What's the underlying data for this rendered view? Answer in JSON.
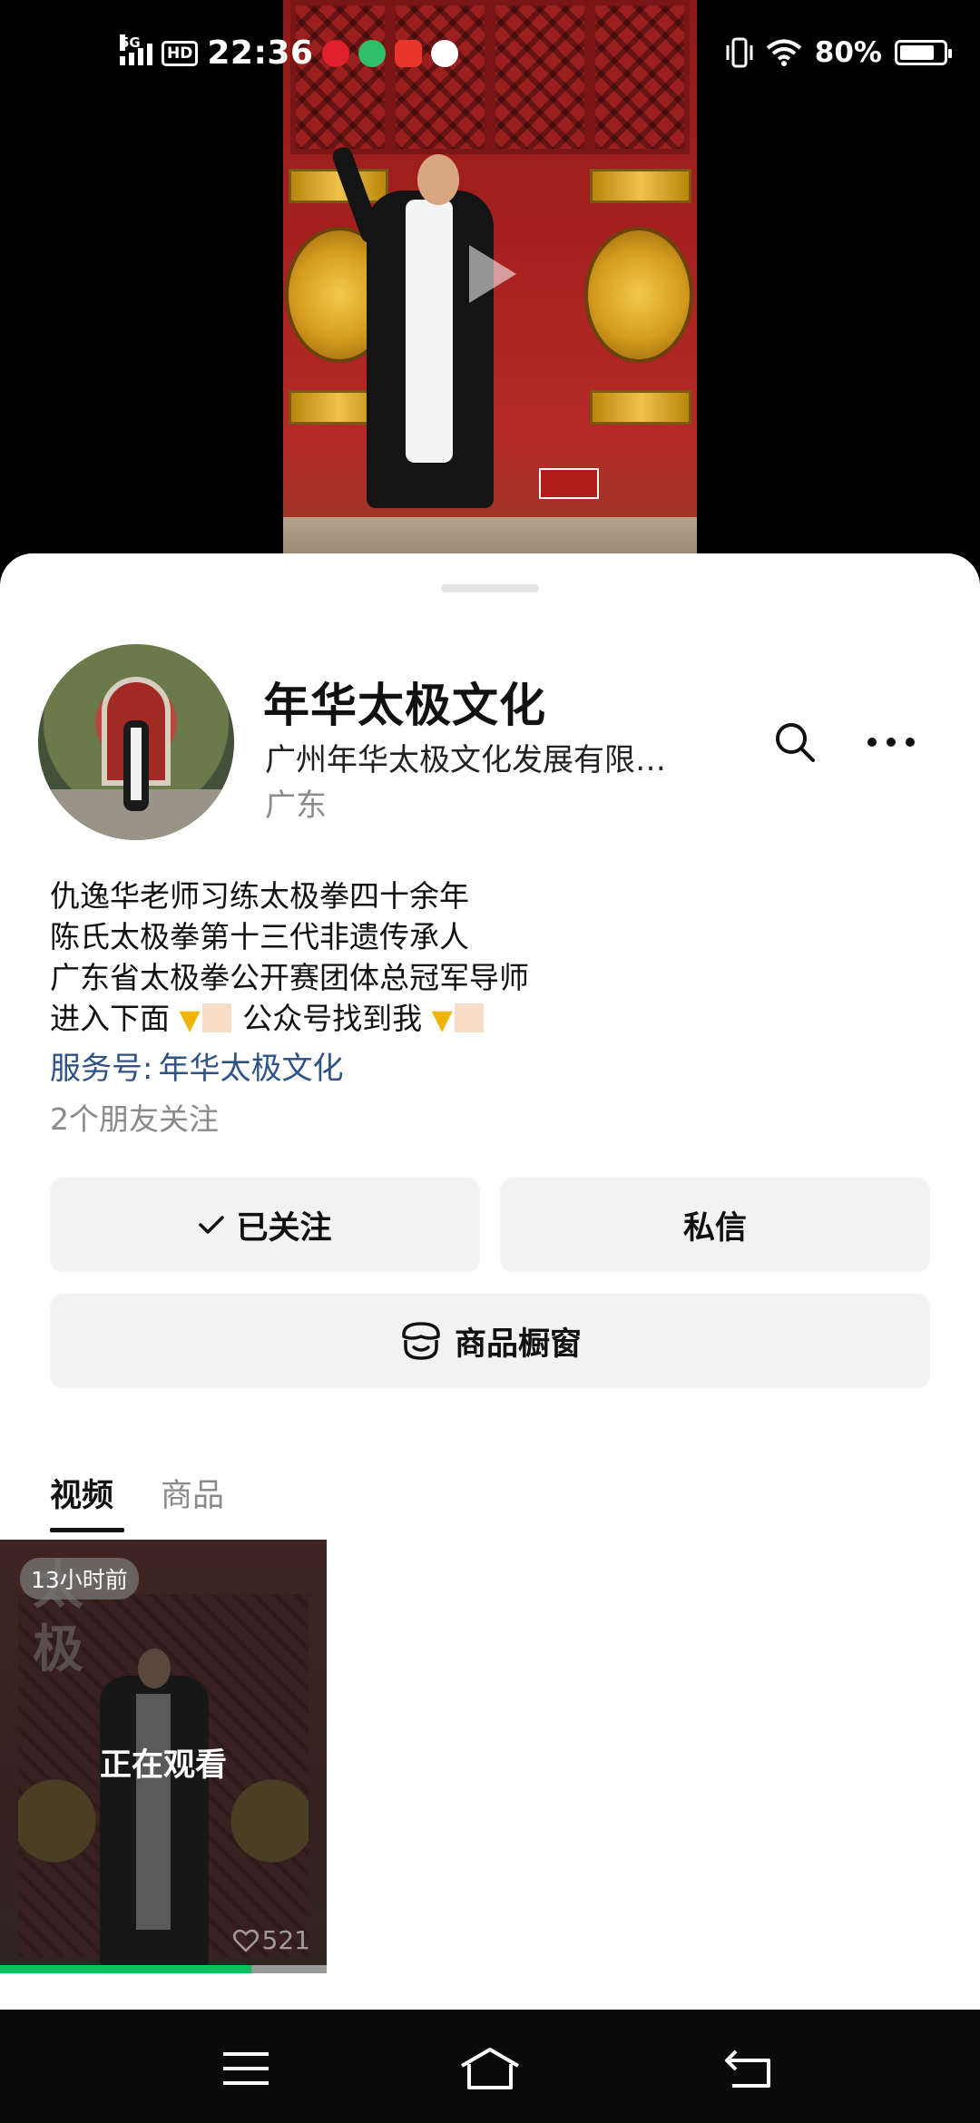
{
  "status_bar": {
    "network": "5G",
    "hd_label": "HD",
    "time": "22:36",
    "battery": "80%",
    "battery_level": 0.8
  },
  "profile": {
    "name": "年华太极文化",
    "company": "广州年华太极文化发展有限…",
    "region": "广东",
    "bio_lines": [
      "仇逸华老师习练太极拳四十余年",
      "陈氏太极拳第十三代非遗传承人",
      "广东省太极拳公开赛团体总冠军导师"
    ],
    "bio_last_line": {
      "part1": "进入下面",
      "part2": "公众号找到我"
    },
    "service_label": "服务号:",
    "service_name": "年华太极文化",
    "friends": "2个朋友关注"
  },
  "buttons": {
    "follow": "已关注",
    "message": "私信",
    "shop": "商品橱窗"
  },
  "tabs": [
    {
      "label": "视频",
      "active": true
    },
    {
      "label": "商品",
      "active": false
    }
  ],
  "video_item": {
    "time_badge": "13小时前",
    "overlay_text": "正在观看",
    "likes": "521",
    "progress": 0.77
  },
  "colors": {
    "accent_green": "#07c160",
    "link_blue": "#2f5387"
  },
  "icons": {
    "search": "search-icon",
    "more": "more-icon",
    "check": "check-icon",
    "shop": "shop-icon",
    "heart": "heart-icon",
    "nav_menu": "menu-icon",
    "nav_home": "home-icon",
    "nav_back": "back-icon"
  }
}
